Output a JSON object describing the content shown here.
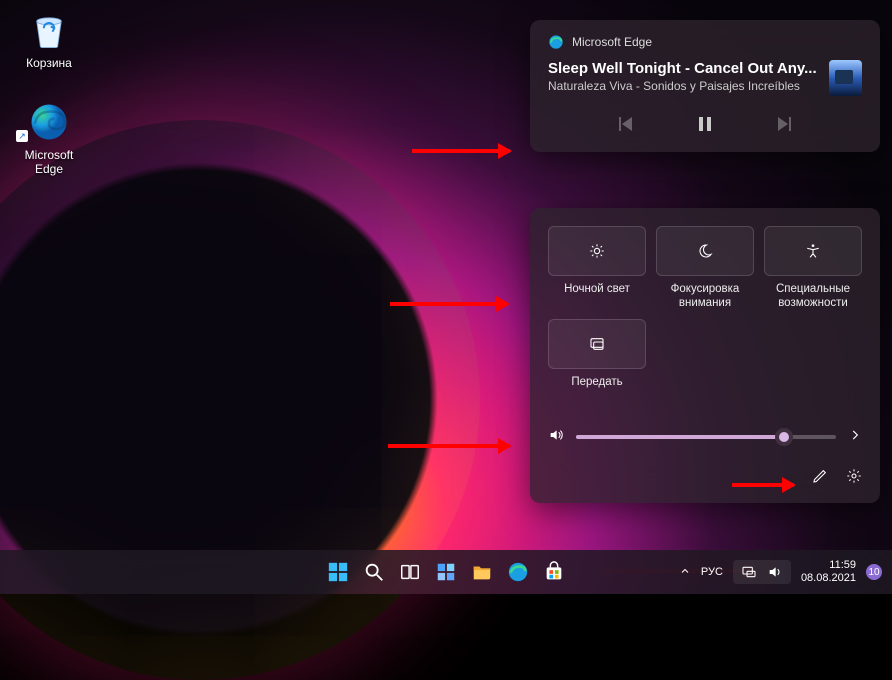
{
  "desktop": {
    "icons": {
      "recycle_bin": "Корзина",
      "edge": "Microsoft Edge"
    }
  },
  "media": {
    "source_app": "Microsoft Edge",
    "title": "Sleep Well Tonight - Cancel Out Any...",
    "artist": "Naturaleza Viva - Sonidos y Paisajes Increíbles"
  },
  "quick_settings": {
    "tiles": [
      {
        "id": "night-light",
        "label": "Ночной свет"
      },
      {
        "id": "focus-assist",
        "label": "Фокусировка внимания"
      },
      {
        "id": "accessibility",
        "label": "Специальные возможности"
      },
      {
        "id": "cast",
        "label": "Передать"
      }
    ],
    "volume_percent": 80
  },
  "taskbar": {
    "lang_short": "РУС",
    "time": "11:59",
    "date": "08.08.2021",
    "notif_count": "10"
  }
}
